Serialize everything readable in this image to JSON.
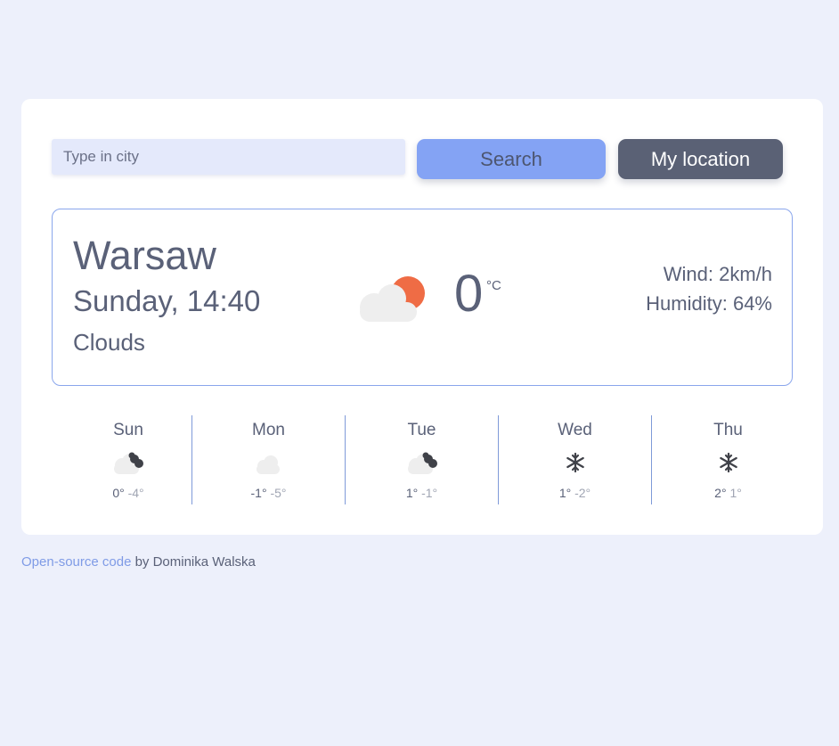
{
  "search": {
    "placeholder": "Type in city",
    "search_label": "Search",
    "location_label": "My location"
  },
  "current": {
    "city": "Warsaw",
    "datetime": "Sunday, 14:40",
    "description": "Clouds",
    "icon": "cloud-sun-icon",
    "temperature": "0",
    "unit": "°C",
    "wind": "Wind: 2km/h",
    "humidity": "Humidity: 64%"
  },
  "forecast": [
    {
      "day": "Sun",
      "icon": "cloud-dark-icon",
      "max": "0°",
      "min": "-4°"
    },
    {
      "day": "Mon",
      "icon": "cloud-icon",
      "max": "-1°",
      "min": "-5°"
    },
    {
      "day": "Tue",
      "icon": "cloud-dark-icon",
      "max": "1°",
      "min": "-1°"
    },
    {
      "day": "Wed",
      "icon": "snowflake-icon",
      "max": "1°",
      "min": "-2°"
    },
    {
      "day": "Thu",
      "icon": "snowflake-icon",
      "max": "2°",
      "min": "1°"
    }
  ],
  "footer": {
    "link_text": "Open-source code",
    "author_text": " by Dominika Walska"
  },
  "colors": {
    "background": "#edf0fb",
    "accent": "#84a3f4",
    "dark_button": "#5a6175",
    "sun": "#ef6c45",
    "cloud": "#eeeeee"
  }
}
